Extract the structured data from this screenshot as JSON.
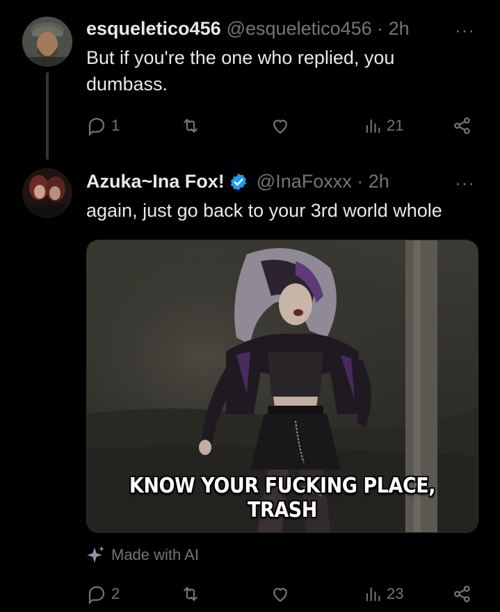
{
  "tweets": [
    {
      "display_name": "esqueletico456",
      "handle_meta": "@esqueletico456 · 2h",
      "text_line1": "But if you're the one who replied, you",
      "text_line2": "dumbass.",
      "replies": "1",
      "views": "21",
      "more": "···"
    },
    {
      "display_name": "Azuka~Ina Fox!",
      "handle_meta": "@InaFoxxx · 2h",
      "text_line1": "again, just go back to your 3rd world whole",
      "image_caption": "KNOW YOUR FUCKING PLACE, TRASH",
      "ai_label": "Made with AI",
      "replies": "2",
      "views": "23",
      "more": "···"
    }
  ],
  "icons": {
    "reply": "reply-icon",
    "repost": "repost-icon",
    "like": "like-icon",
    "views": "views-icon",
    "share": "share-icon",
    "verified": "verified-badge-icon",
    "sparkle": "sparkle-icon"
  },
  "colors": {
    "background": "#000000",
    "text": "#e7e9ea",
    "muted": "#71767b",
    "verified": "#1d9bf0"
  }
}
